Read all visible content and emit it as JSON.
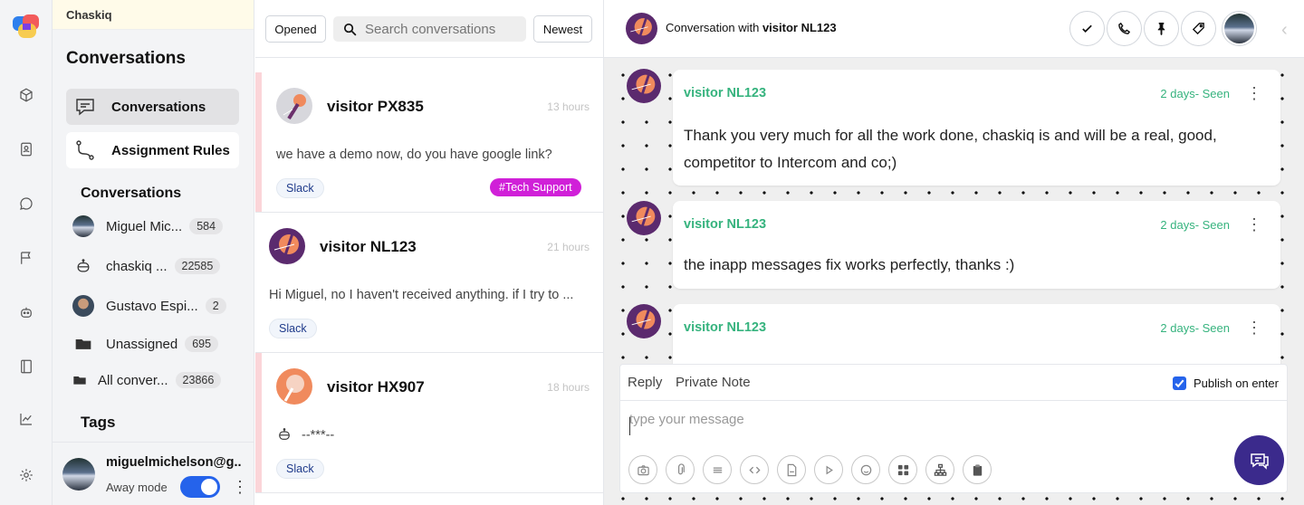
{
  "app": {
    "name": "Chaskiq"
  },
  "sidebar": {
    "title": "Conversations",
    "nav": [
      {
        "label": "Conversations",
        "icon": "chat-icon"
      },
      {
        "label": "Assignment Rules",
        "icon": "route-icon"
      }
    ],
    "folders_title": "Conversations",
    "folders": [
      {
        "label": "Miguel Mic...",
        "count": "584",
        "icon": "avatar"
      },
      {
        "label": "chaskiq ...",
        "count": "22585",
        "icon": "bot-icon"
      },
      {
        "label": "Gustavo Espi...",
        "count": "2",
        "icon": "avatar"
      },
      {
        "label": "Unassigned",
        "count": "695",
        "icon": "folder-icon"
      },
      {
        "label": "All conver...",
        "count": "23866",
        "icon": "folder-icon"
      }
    ],
    "tags_title": "Tags",
    "user": {
      "email": "miguelmichelson@g...",
      "away_label": "Away mode",
      "away_on": true
    }
  },
  "list": {
    "filter_label": "Opened",
    "search_placeholder": "Search conversations",
    "sort_label": "Newest",
    "items": [
      {
        "name": "visitor PX835",
        "time": "13 hours",
        "message": "we have a demo now, do you have google link?",
        "channel": "Slack",
        "tag": "#Tech Support"
      },
      {
        "name": "visitor NL123",
        "time": "21 hours",
        "message": "Hi Miguel, no I haven't received anything. if I try to ...",
        "channel": "Slack"
      },
      {
        "name": "visitor HX907",
        "time": "18 hours",
        "message": "--***--",
        "channel": "Slack"
      }
    ]
  },
  "conversation": {
    "title_prefix": "Conversation with",
    "visitor": "visitor NL123",
    "messages": [
      {
        "author": "visitor NL123",
        "meta": "2 days- Seen",
        "text": "Thank you very much for all the work done, chaskiq is and will be a real, good, competitor to Intercom and co;)"
      },
      {
        "author": "visitor NL123",
        "meta": "2 days- Seen",
        "text": "the inapp messages fix works perfectly, thanks :)"
      },
      {
        "author": "visitor NL123",
        "meta": "2 days- Seen",
        "text": ""
      }
    ]
  },
  "composer": {
    "tabs": [
      "Reply",
      "Private Note"
    ],
    "publish_label": "Publish on enter",
    "publish_checked": true,
    "placeholder": "type your message"
  },
  "colors": {
    "accent": "#2563eb",
    "seen": "#36b37e",
    "tag": "#d020d8",
    "fab": "#3b2a8c"
  }
}
